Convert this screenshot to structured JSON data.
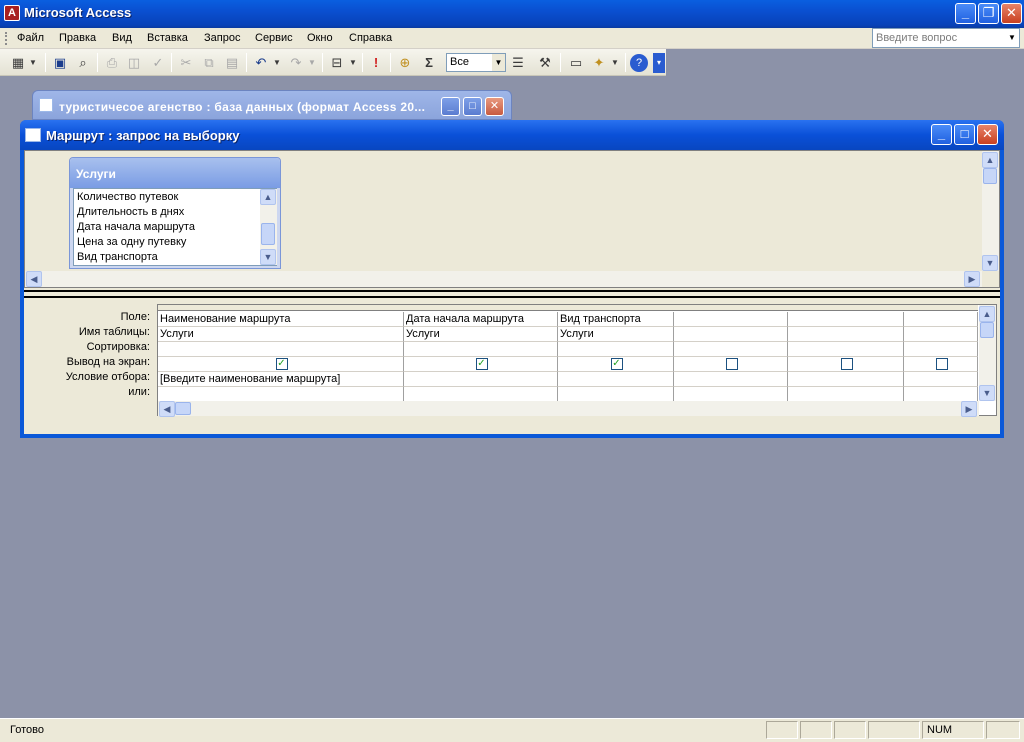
{
  "app": {
    "title": "Microsoft Access",
    "icon_letter": "A"
  },
  "window_buttons": {
    "minimize": "_",
    "restore": "❐",
    "close": "✕"
  },
  "menu": {
    "items": [
      "Файл",
      "Правка",
      "Вид",
      "Вставка",
      "Запрос",
      "Сервис",
      "Окно",
      "Справка"
    ],
    "ask_placeholder": "Введите вопрос"
  },
  "toolbar": {
    "top_values": "Все",
    "sigma": "Σ",
    "run": "!"
  },
  "db_window": {
    "title": "туристичесое агенство : база данных (формат Access 20..."
  },
  "query_window": {
    "title": "Маршрут : запрос на выборку",
    "table": {
      "name": "Услуги",
      "fields": [
        "Количество путевок",
        "Длительность в днях",
        "Дата начала маршрута",
        "Цена за одну путевку",
        "Вид транспорта"
      ]
    },
    "row_labels": [
      "Поле:",
      "Имя таблицы:",
      "Сортировка:",
      "Вывод на экран:",
      "Условие отбора:",
      "или:"
    ],
    "columns": [
      {
        "field": "Наименование маршрута",
        "table": "Услуги",
        "sort": "",
        "show": true,
        "criteria": "[Введите наименование маршрута]",
        "or": ""
      },
      {
        "field": "Дата начала маршрута",
        "table": "Услуги",
        "sort": "",
        "show": true,
        "criteria": "",
        "or": ""
      },
      {
        "field": "Вид транспорта",
        "table": "Услуги",
        "sort": "",
        "show": true,
        "criteria": "",
        "or": ""
      },
      {
        "field": "",
        "table": "",
        "sort": "",
        "show": false,
        "criteria": "",
        "or": ""
      },
      {
        "field": "",
        "table": "",
        "sort": "",
        "show": false,
        "criteria": "",
        "or": ""
      },
      {
        "field": "",
        "table": "",
        "sort": "",
        "show": false,
        "criteria": "",
        "or": ""
      }
    ]
  },
  "status": {
    "left": "Готово",
    "num": "NUM"
  },
  "colors": {
    "title_bar": "#0a4fd0",
    "desktop": "#8c92a8",
    "check": "#21a121"
  }
}
